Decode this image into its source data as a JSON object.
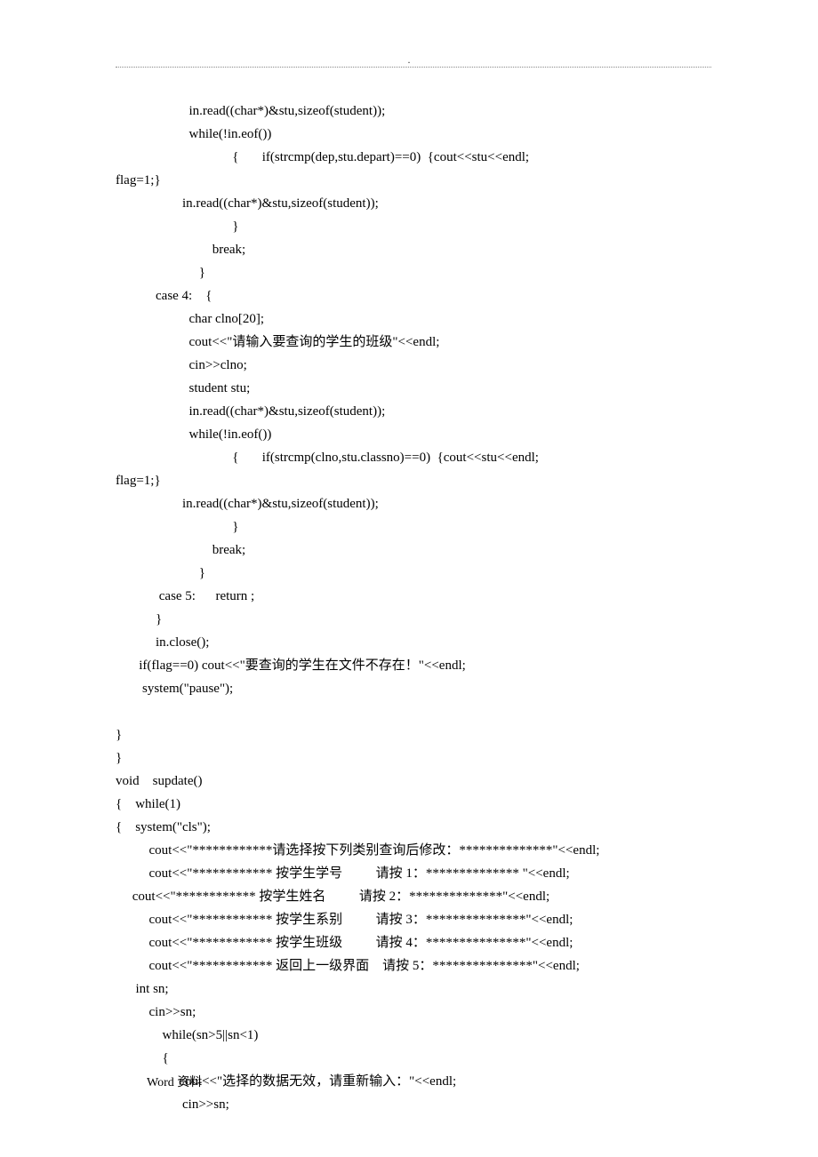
{
  "topDot": ".",
  "code": "                      in.read((char*)&stu,sizeof(student));\n                      while(!in.eof())\n                                   {       if(strcmp(dep,stu.depart)==0)  {cout<<stu<<endl;\nflag=1;}\n                    in.read((char*)&stu,sizeof(student));\n                                   }\n                             break;\n                         }\n            case 4:    {\n                      char clno[20];\n                      cout<<\"请输入要查询的学生的班级\"<<endl;\n                      cin>>clno;\n                      student stu;\n                      in.read((char*)&stu,sizeof(student));\n                      while(!in.eof())\n                                   {       if(strcmp(clno,stu.classno)==0)  {cout<<stu<<endl;\nflag=1;}\n                    in.read((char*)&stu,sizeof(student));\n                                   }\n                             break;\n                         }\n             case 5:      return ;\n            }\n            in.close();\n       if(flag==0) cout<<\"要查询的学生在文件不存在！\"<<endl;\n        system(\"pause\");\n\n}\n}\nvoid    supdate()\n{    while(1)\n{    system(\"cls\");\n          cout<<\"************请选择按下列类别查询后修改：**************\"<<endl;\n          cout<<\"************ 按学生学号          请按 1：************** \"<<endl;\n     cout<<\"************ 按学生姓名          请按 2：**************\"<<endl;\n          cout<<\"************ 按学生系别          请按 3：***************\"<<endl;\n          cout<<\"************ 按学生班级          请按 4：***************\"<<endl;\n          cout<<\"************ 返回上一级界面    请按 5：***************\"<<endl;\n      int sn;\n          cin>>sn;\n              while(sn>5||sn<1)\n              {\n                   cout<<\"选择的数据无效，请重新输入：\"<<endl;\n                    cin>>sn;",
  "footer": "Word 资料"
}
